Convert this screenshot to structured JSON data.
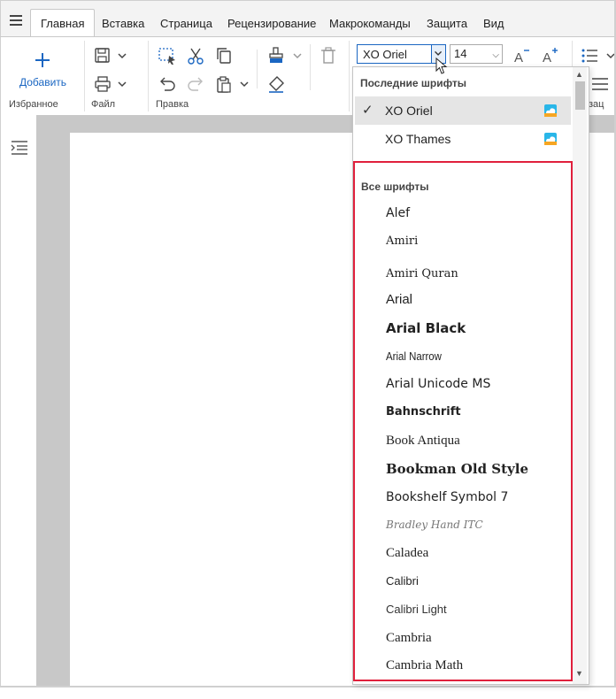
{
  "tabs": [
    {
      "label": "Главная",
      "active": true
    },
    {
      "label": "Вставка",
      "active": false
    },
    {
      "label": "Страница",
      "active": false
    },
    {
      "label": "Рецензирование",
      "active": false
    },
    {
      "label": "Макрокоманды",
      "active": false
    },
    {
      "label": "Защита",
      "active": false
    },
    {
      "label": "Вид",
      "active": false
    }
  ],
  "ribbon": {
    "add_label": "Добавить",
    "groups": {
      "favorites": "Избранное",
      "file": "Файл",
      "edit": "Правка",
      "paragraph_partial": "зац"
    },
    "font_name": "XO Oriel",
    "font_size": "14",
    "accent_color": "#1a66c2"
  },
  "dropdown": {
    "recent_header": "Последние шрифты",
    "recent": [
      {
        "name": "XO Oriel",
        "selected": true
      },
      {
        "name": "XO Thames",
        "selected": false
      }
    ],
    "all_header": "Все шрифты",
    "all": [
      "Alef",
      "Amiri",
      "Amiri Quran",
      "Arial",
      "Arial Black",
      "Arial Narrow",
      "Arial Unicode MS",
      "Bahnschrift",
      "Book Antiqua",
      "Bookman Old Style",
      "Bookshelf Symbol 7",
      "Bradley Hand ITC",
      "Caladea",
      "Calibri",
      "Calibri Light",
      "Cambria",
      "Cambria Math"
    ],
    "highlight_color": "#e0203c"
  }
}
